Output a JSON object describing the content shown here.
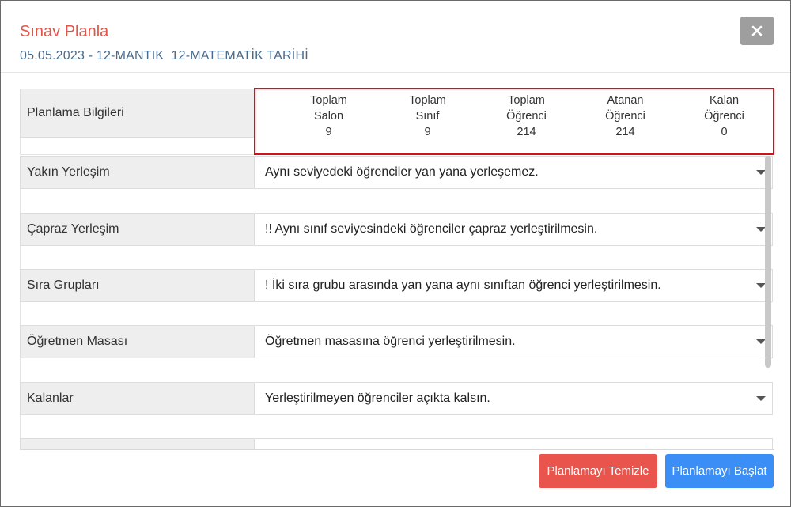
{
  "header": {
    "title": "Sınav Planla",
    "subtitle": "05.05.2023 - 12-MANTIK  12-MATEMATİK TARİHİ"
  },
  "info": {
    "label": "Planlama Bilgileri",
    "stats": [
      {
        "line1": "Toplam",
        "line2": "Salon",
        "value": "9"
      },
      {
        "line1": "Toplam",
        "line2": "Sınıf",
        "value": "9"
      },
      {
        "line1": "Toplam",
        "line2": "Öğrenci",
        "value": "214"
      },
      {
        "line1": "Atanan",
        "line2": "Öğrenci",
        "value": "214"
      },
      {
        "line1": "Kalan",
        "line2": "Öğrenci",
        "value": "0"
      }
    ]
  },
  "rows": [
    {
      "label": "Yakın Yerleşim",
      "value": "Aynı seviyedeki öğrenciler yan yana yerleşemez."
    },
    {
      "label": "Çapraz Yerleşim",
      "value": "!! Aynı sınıf seviyesindeki öğrenciler çapraz yerleştirilmesin."
    },
    {
      "label": "Sıra Grupları",
      "value": "! İki sıra grubu arasında yan yana aynı sınıftan öğrenci yerleştirilmesin."
    },
    {
      "label": "Öğretmen Masası",
      "value": "Öğretmen masasına öğrenci yerleştirilmesin."
    },
    {
      "label": "Kalanlar",
      "value": "Yerleştirilmeyen öğrenciler açıkta kalsın."
    }
  ],
  "buttons": {
    "clear": "Planlamayı Temizle",
    "start": "Planlamayı Başlat"
  },
  "colors": {
    "title": "#e0564a",
    "highlight_border": "#d0121b",
    "clear_button": "#e9544c",
    "start_button": "#3a8ef6"
  }
}
